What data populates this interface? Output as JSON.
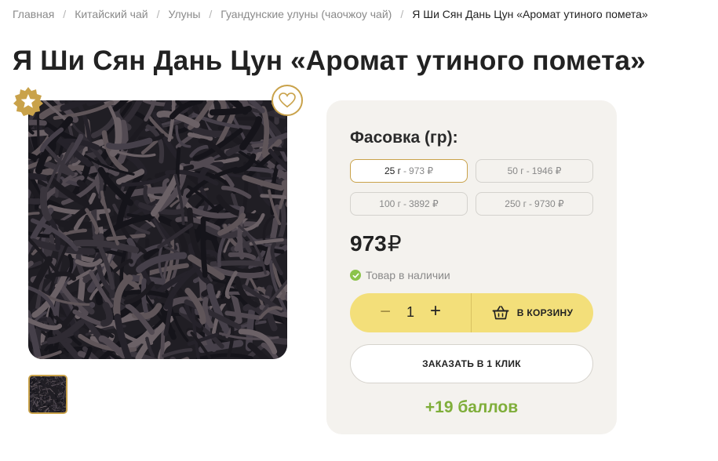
{
  "breadcrumb": [
    {
      "label": "Главная"
    },
    {
      "label": "Китайский чай"
    },
    {
      "label": "Улуны"
    },
    {
      "label": "Гуандунские улуны (чаочжоу чай)"
    },
    {
      "label": "Я Ши Сян Дань Цун «Аромат утиного помета»"
    }
  ],
  "product": {
    "title": "Я Ши Сян Дань Цун «Аромат утиного помета»",
    "accent_color": "#c9a24a",
    "image_icon": "tea-leaves-photo"
  },
  "packing": {
    "title": "Фасовка (гр):",
    "options": [
      {
        "weight": "25 г",
        "price": "973 ₽",
        "selected": true
      },
      {
        "weight": "50 г",
        "price": "1946 ₽",
        "selected": false
      },
      {
        "weight": "100 г",
        "price": "3892 ₽",
        "selected": false
      },
      {
        "weight": "250 г",
        "price": "9730 ₽",
        "selected": false
      }
    ],
    "separator": "-"
  },
  "price": {
    "value": "973",
    "currency": "₽"
  },
  "stock": {
    "text": "Товар в наличии",
    "color": "#8bc34a"
  },
  "cart": {
    "minus": "−",
    "quantity": "1",
    "plus": "+",
    "add_label": "В КОРЗИНУ",
    "button_color": "#f3df7a"
  },
  "one_click": {
    "label": "ЗАКАЗАТЬ В 1 КЛИК"
  },
  "bonus": {
    "text": "+19 баллов",
    "color": "#7fae3a"
  }
}
